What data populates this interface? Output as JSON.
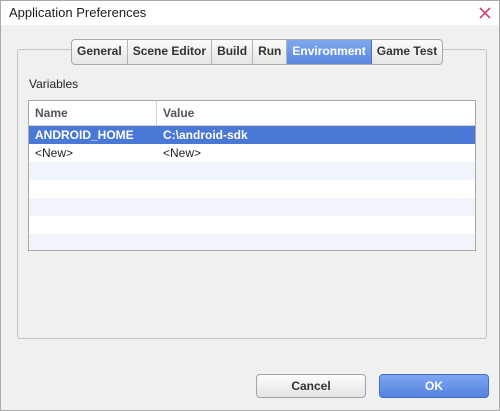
{
  "window": {
    "title": "Application Preferences"
  },
  "tabs": [
    {
      "label": "General",
      "active": false
    },
    {
      "label": "Scene Editor",
      "active": false
    },
    {
      "label": "Build",
      "active": false
    },
    {
      "label": "Run",
      "active": false
    },
    {
      "label": "Environment",
      "active": true
    },
    {
      "label": "Game Test",
      "active": false
    }
  ],
  "variables": {
    "section_label": "Variables",
    "columns": {
      "name": "Name",
      "value": "Value"
    },
    "rows": [
      {
        "name": "ANDROID_HOME",
        "value": "C:\\android-sdk",
        "selected": true
      },
      {
        "name": "<New>",
        "value": "<New>",
        "selected": false
      }
    ]
  },
  "buttons": {
    "cancel": "Cancel",
    "ok": "OK"
  },
  "colors": {
    "accent": "#5a88df",
    "selection": "#4a78d6",
    "close": "#d0426b"
  }
}
